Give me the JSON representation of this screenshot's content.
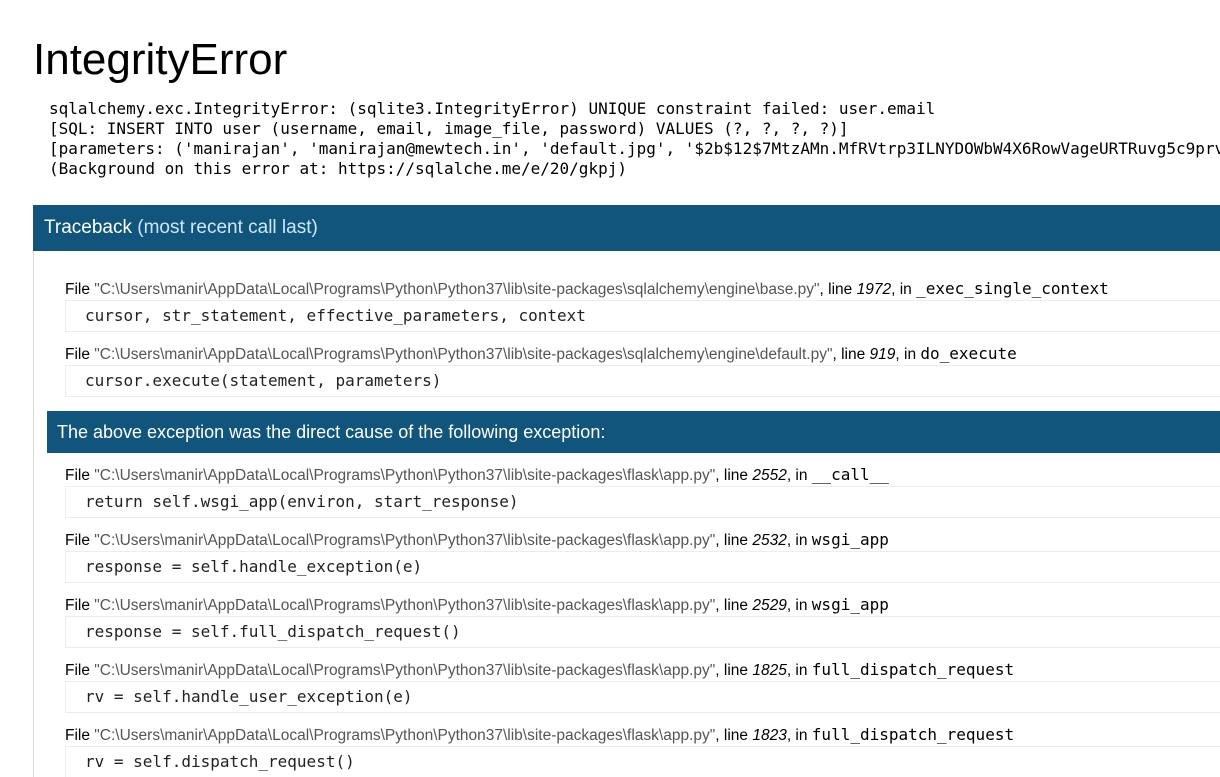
{
  "title": "IntegrityError",
  "error_message": "sqlalchemy.exc.IntegrityError: (sqlite3.IntegrityError) UNIQUE constraint failed: user.email\n[SQL: INSERT INTO user (username, email, image_file, password) VALUES (?, ?, ?, ?)]\n[parameters: ('manirajan', 'manirajan@mewtech.in', 'default.jpg', '$2b$12$7MtzAMn.MfRVtrp3ILNYDOWbW4X6RowVageURTRuvg5c9prv\n(Background on this error at: https://sqlalche.me/e/20/gkpj)",
  "traceback": {
    "heading": "Traceback",
    "subheading": "(most recent call last)"
  },
  "labels": {
    "file": "File ",
    "line": ", line ",
    "in": ", in "
  },
  "frames_before": [
    {
      "filename": "\"C:\\Users\\manir\\AppData\\Local\\Programs\\Python\\Python37\\lib\\site-packages\\sqlalchemy\\engine\\base.py\"",
      "line": "1972",
      "function": "_exec_single_context",
      "code": "cursor, str_statement, effective_parameters, context"
    },
    {
      "filename": "\"C:\\Users\\manir\\AppData\\Local\\Programs\\Python\\Python37\\lib\\site-packages\\sqlalchemy\\engine\\default.py\"",
      "line": "919",
      "function": "do_execute",
      "code": "cursor.execute(statement, parameters)"
    }
  ],
  "cause_text": "The above exception was the direct cause of the following exception:",
  "frames_after": [
    {
      "filename": "\"C:\\Users\\manir\\AppData\\Local\\Programs\\Python\\Python37\\lib\\site-packages\\flask\\app.py\"",
      "line": "2552",
      "function": "__call__",
      "code": "return self.wsgi_app(environ, start_response)"
    },
    {
      "filename": "\"C:\\Users\\manir\\AppData\\Local\\Programs\\Python\\Python37\\lib\\site-packages\\flask\\app.py\"",
      "line": "2532",
      "function": "wsgi_app",
      "code": "response = self.handle_exception(e)"
    },
    {
      "filename": "\"C:\\Users\\manir\\AppData\\Local\\Programs\\Python\\Python37\\lib\\site-packages\\flask\\app.py\"",
      "line": "2529",
      "function": "wsgi_app",
      "code": "response = self.full_dispatch_request()"
    },
    {
      "filename": "\"C:\\Users\\manir\\AppData\\Local\\Programs\\Python\\Python37\\lib\\site-packages\\flask\\app.py\"",
      "line": "1825",
      "function": "full_dispatch_request",
      "code": "rv = self.handle_user_exception(e)"
    },
    {
      "filename": "\"C:\\Users\\manir\\AppData\\Local\\Programs\\Python\\Python37\\lib\\site-packages\\flask\\app.py\"",
      "line": "1823",
      "function": "full_dispatch_request",
      "code": "rv = self.dispatch_request()"
    }
  ]
}
